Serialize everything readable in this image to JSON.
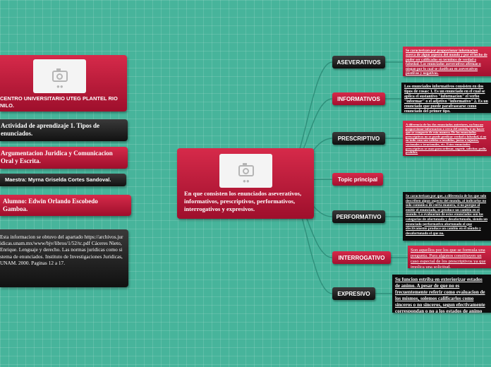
{
  "central": {
    "text": "En que consisten los enunciados aseverativos, informativos, prescriptivos, performativos, interrogativos y expresivos."
  },
  "left": {
    "institution": "CENTRO UNIVERSITARIO UTEG PLANTEL RIO NILO.",
    "activity": "Actividad de aprendizaje 1. Tipos de enunciados.",
    "subject": "Argumentacion Juridica y Comunicacion Oral y Escrita.",
    "teacher": "Maestra: Myrna Griselda Cortes Sandoval.",
    "student": "Alumno: Edwin Orlando Escobedo Gamboa.",
    "source": "Esta informacion se obtuvo del apartado https://archivos.juridicas.unam.mx/www/bjv/libros/1/52/tc.pdf     Cáceres Nieto, Enrique. Lenguaje y derecho. Las normas juridicas como sistema de enunciados. Instituto de Investigaciones Juridicas, UNAM. 2000. Paginas 12 a 17."
  },
  "branches": [
    {
      "label": "ASEVERATIVOS",
      "note": "Se caracterizan por proporcionar informacion acerca de algun aspecto del mundo y por el hecho de poder ser calificados en terminos de verdad o falsedad. Los enunciados aseverativos afirman o niegan por lo cual se clasifican en aseverativos positivos y negativos."
    },
    {
      "label": "INFORMATIVOS",
      "note": "Los enunciados informativos consisten en dos tipos de cosas: 1. Es un enunciado en el cual se aplica el sustantivo \"informacion\" el verbo \"informar\" o el adjetivo \"informativo\" 2. Es un enunciado que puede parafrasearse como enunciado del primer tipo."
    },
    {
      "label": "PRESCRIPTIVO",
      "note": "A diferencia de los dos enunciados anteriores, no buscan proporcionar informacion a cerca del mundo, si no hacer que se comporte de esta manera. De los enunciados prescriptivos no se puede predicar verdad o falsedad, si no en todo caso son validos o invalidos, justos o injustos, racionales o irracionales, etc. Estos enunciados prescriptivos se usan para ordenar, sugerir, solicitar, pedir, prohibir."
    },
    {
      "label": "Topic principal",
      "note": ""
    },
    {
      "label": "PERFORMATIVO",
      "note": "Se caracterizan por que, a diferencia de los que solo describen algun aspecto del mundo, al indicarlos no solo comunica de cierta manera, si no porque al emitir el enunciado, se produce un cambio en el mundo. La evaluacion de estos enunciados son las categorias de afortunado y desafortunado, siendo un enunciado performativo afortunado el que efectivamente produce un cambio en el mundo y desafortunado el que no."
    },
    {
      "label": "INTERROGATIVO",
      "note": "Son aquellos por los que se formula una pregunta. Para algunos constituyen un caso especial de los prescriptivos ya que implica una solicitud."
    },
    {
      "label": "EXPRESIVO",
      "note": "Su funcion estriba en exteriorizar estados de animo. A pesar de que no es frecuentemente referir como evaluacion de los mismos, solemos calificarlos como sinceros o no sinceros, segun efectivamente correspondan o no a los estados de animo manifestado."
    }
  ]
}
